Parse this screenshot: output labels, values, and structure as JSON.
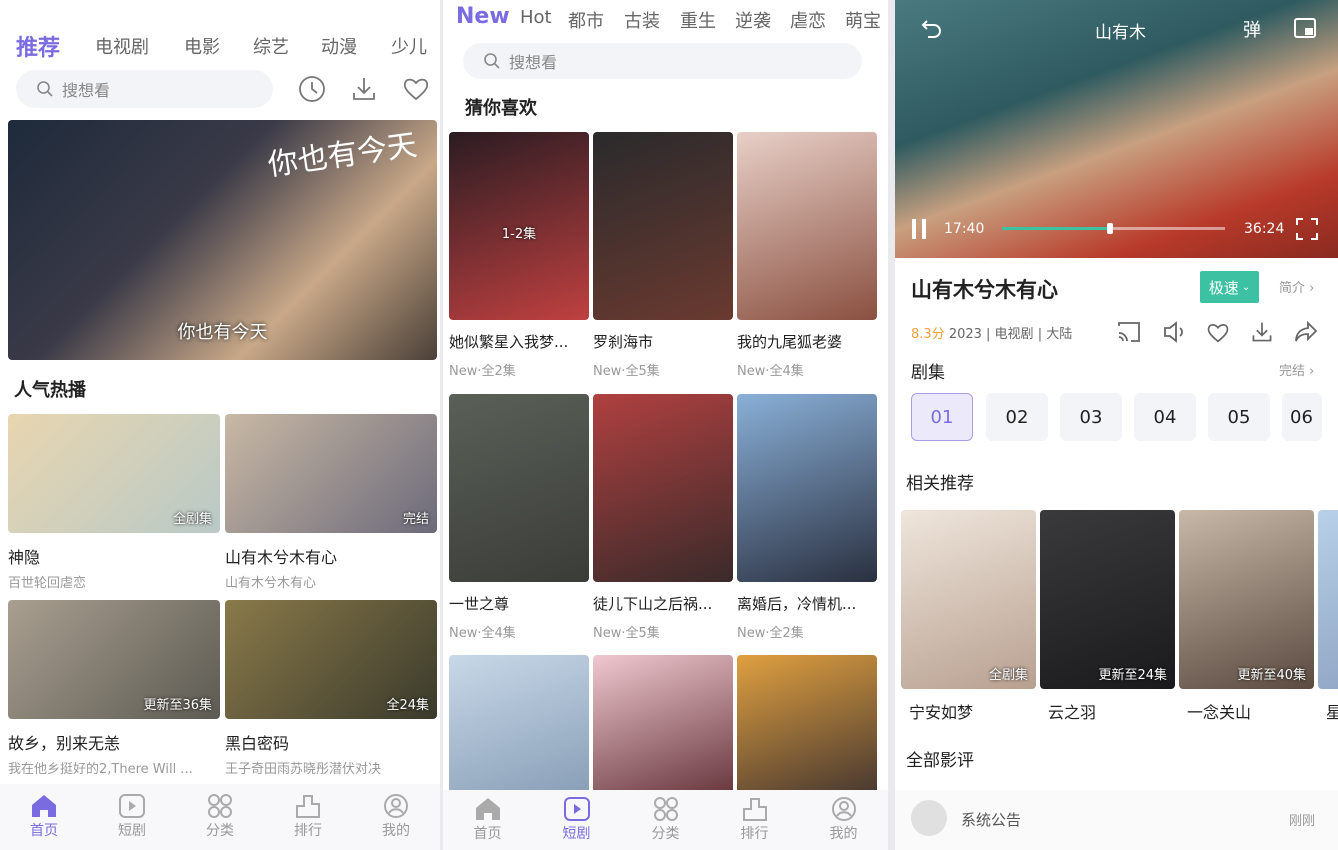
{
  "colors": {
    "accent": "#7a6ce0",
    "green": "#3cc2a2",
    "score": "#f0a040"
  },
  "home": {
    "tabs": [
      "推荐",
      "电视剧",
      "电影",
      "综艺",
      "动漫",
      "少儿"
    ],
    "search_placeholder": "搜想看",
    "icons": [
      "history-icon",
      "download-icon",
      "favorite-icon"
    ],
    "banner": {
      "caption": "你也有今天",
      "logo_text": "你也有今天"
    },
    "section": "人气热播",
    "cards": [
      {
        "title": "神隐",
        "sub": "百世轮回虐恋",
        "badge": "全剧集",
        "c1": "#e8d6b0",
        "c2": "#b9c9c7"
      },
      {
        "title": "山有木兮木有心",
        "sub": "山有木兮木有心",
        "badge": "完结",
        "c1": "#c9b9a5",
        "c2": "#6c6a7a"
      },
      {
        "title": "故乡，别来无恙",
        "sub": "我在他乡挺好的2,There Will ...",
        "badge": "更新至36集",
        "c1": "#a99f90",
        "c2": "#5c5a52"
      },
      {
        "title": "黑白密码",
        "sub": "王子奇田雨苏晓彤潜伏对决",
        "badge": "全24集",
        "c1": "#8a7a4a",
        "c2": "#3a3a2c"
      }
    ],
    "nav": [
      {
        "label": "首页",
        "icon": "home-icon"
      },
      {
        "label": "短剧",
        "icon": "play-icon"
      },
      {
        "label": "分类",
        "icon": "category-icon"
      },
      {
        "label": "排行",
        "icon": "ranking-icon"
      },
      {
        "label": "我的",
        "icon": "profile-icon"
      }
    ],
    "nav_active": 0
  },
  "short": {
    "tabs": [
      "New",
      "Hot",
      "都市",
      "古装",
      "重生",
      "逆袭",
      "虐恋",
      "萌宝"
    ],
    "search_placeholder": "搜想看",
    "section": "猜你喜欢",
    "cards": [
      {
        "title": "她似繁星入我梦...",
        "meta": "New·全2集",
        "badge": "1-2集",
        "c1": "#2a1c22",
        "c2": "#c04040"
      },
      {
        "title": "罗刹海市",
        "meta": "New·全5集",
        "badge": "",
        "c1": "#2a2a2c",
        "c2": "#6a3a30"
      },
      {
        "title": "我的九尾狐老婆",
        "meta": "New·全4集",
        "badge": "",
        "c1": "#e8d0c8",
        "c2": "#8a5040"
      },
      {
        "title": "一世之尊",
        "meta": "New·全4集",
        "badge": "",
        "c1": "#5a6058",
        "c2": "#3a3c38"
      },
      {
        "title": "徒儿下山之后祸...",
        "meta": "New·全5集",
        "badge": "",
        "c1": "#b04040",
        "c2": "#3a2a2a"
      },
      {
        "title": "离婚后，冷情机...",
        "meta": "New·全2集",
        "badge": "",
        "c1": "#8ab0d8",
        "c2": "#2a3040"
      },
      {
        "title": "",
        "meta": "",
        "badge": "",
        "c1": "#c8d8e8",
        "c2": "#8aa0b8"
      },
      {
        "title": "",
        "meta": "",
        "badge": "",
        "c1": "#f0c8d0",
        "c2": "#6a3a40"
      },
      {
        "title": "",
        "meta": "",
        "badge": "",
        "c1": "#e0a040",
        "c2": "#4a3a30"
      }
    ],
    "nav": [
      {
        "label": "首页",
        "icon": "home-icon"
      },
      {
        "label": "短剧",
        "icon": "play-icon"
      },
      {
        "label": "分类",
        "icon": "category-icon"
      },
      {
        "label": "排行",
        "icon": "ranking-icon"
      },
      {
        "label": "我的",
        "icon": "profile-icon"
      }
    ],
    "nav_active": 1
  },
  "detail": {
    "player": {
      "title": "山有木",
      "danmaku": "弹",
      "current_time": "17:40",
      "total_time": "36:24",
      "progress": 0.485
    },
    "title": "山有木兮木有心",
    "speed_button": "极速",
    "intro_link": "简介",
    "score": "8.3分",
    "meta": "2023 | 电视剧 | 大陆",
    "action_icons": [
      "cast-icon",
      "audio-icon",
      "favorite-icon",
      "download-icon",
      "share-icon"
    ],
    "episodes_label": "剧集",
    "episodes_status": "完结",
    "episodes": [
      "01",
      "02",
      "03",
      "04",
      "05",
      "06"
    ],
    "episode_active": 0,
    "related_label": "相关推荐",
    "related": [
      {
        "title": "宁安如梦",
        "badge": "全剧集",
        "c1": "#efe6dc",
        "c2": "#b8a090"
      },
      {
        "title": "云之羽",
        "badge": "更新至24集",
        "c1": "#3a3a3c",
        "c2": "#1a1a1c"
      },
      {
        "title": "一念关山",
        "badge": "更新至40集",
        "c1": "#c8b8a8",
        "c2": "#5a4a40"
      },
      {
        "title": "星",
        "badge": "",
        "c1": "#b8d0e8",
        "c2": "#8aa0c0"
      }
    ],
    "reviews_label": "全部影评",
    "review": {
      "author": "系统公告",
      "time": "刚刚"
    }
  }
}
